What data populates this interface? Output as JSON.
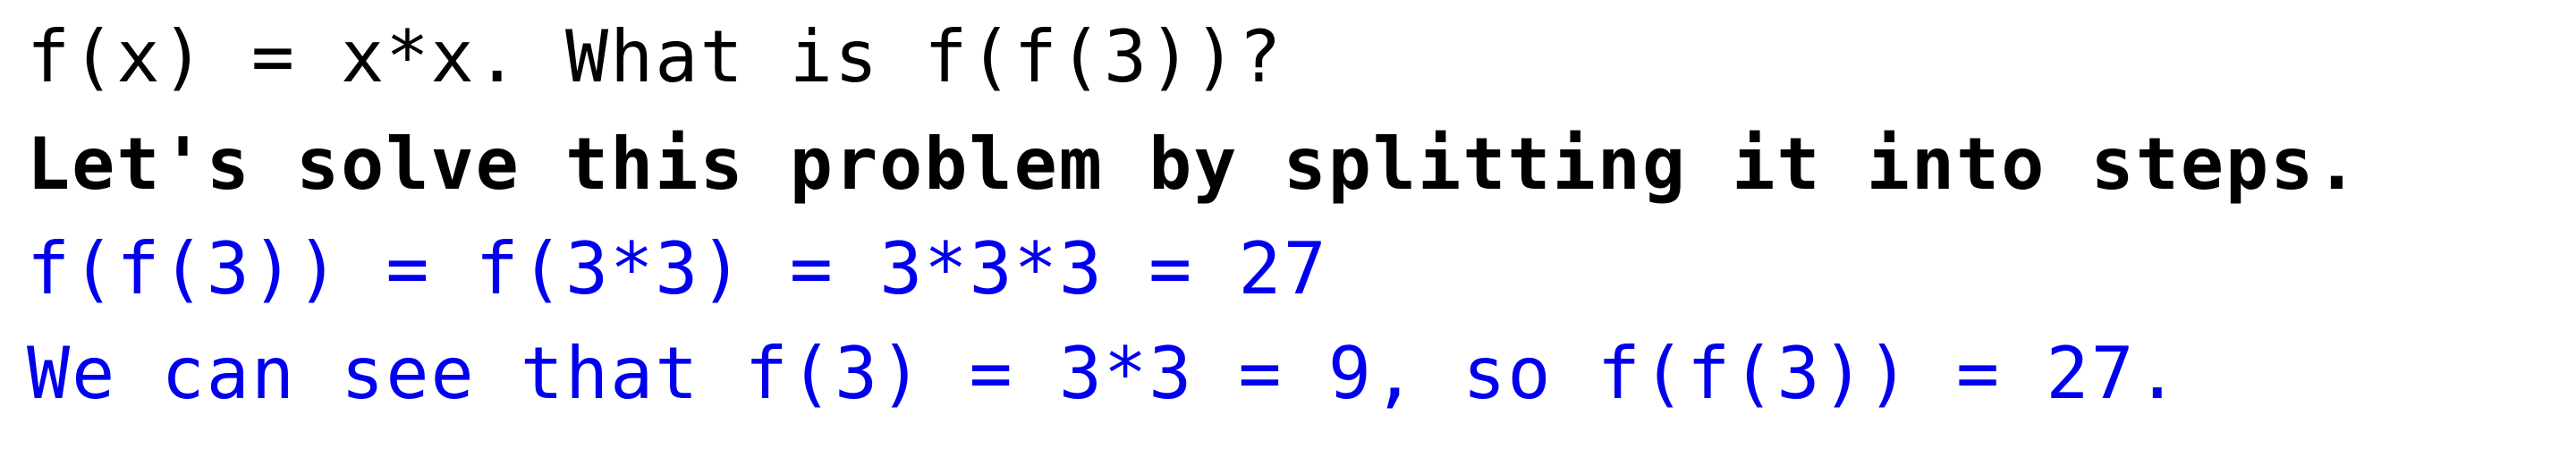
{
  "document": {
    "prompt": "f(x) = x*x. What is f(f(3))?",
    "instruction": "Let's solve this problem by splitting it into steps.",
    "step_1": "f(f(3)) = f(3*3) = 3*3*3 = 27",
    "step_2": "We can see that f(3) = 3*3 = 9, so f(f(3)) = 27."
  },
  "colors": {
    "text": "#000000",
    "response": "#0000ee",
    "background": "#ffffff"
  }
}
